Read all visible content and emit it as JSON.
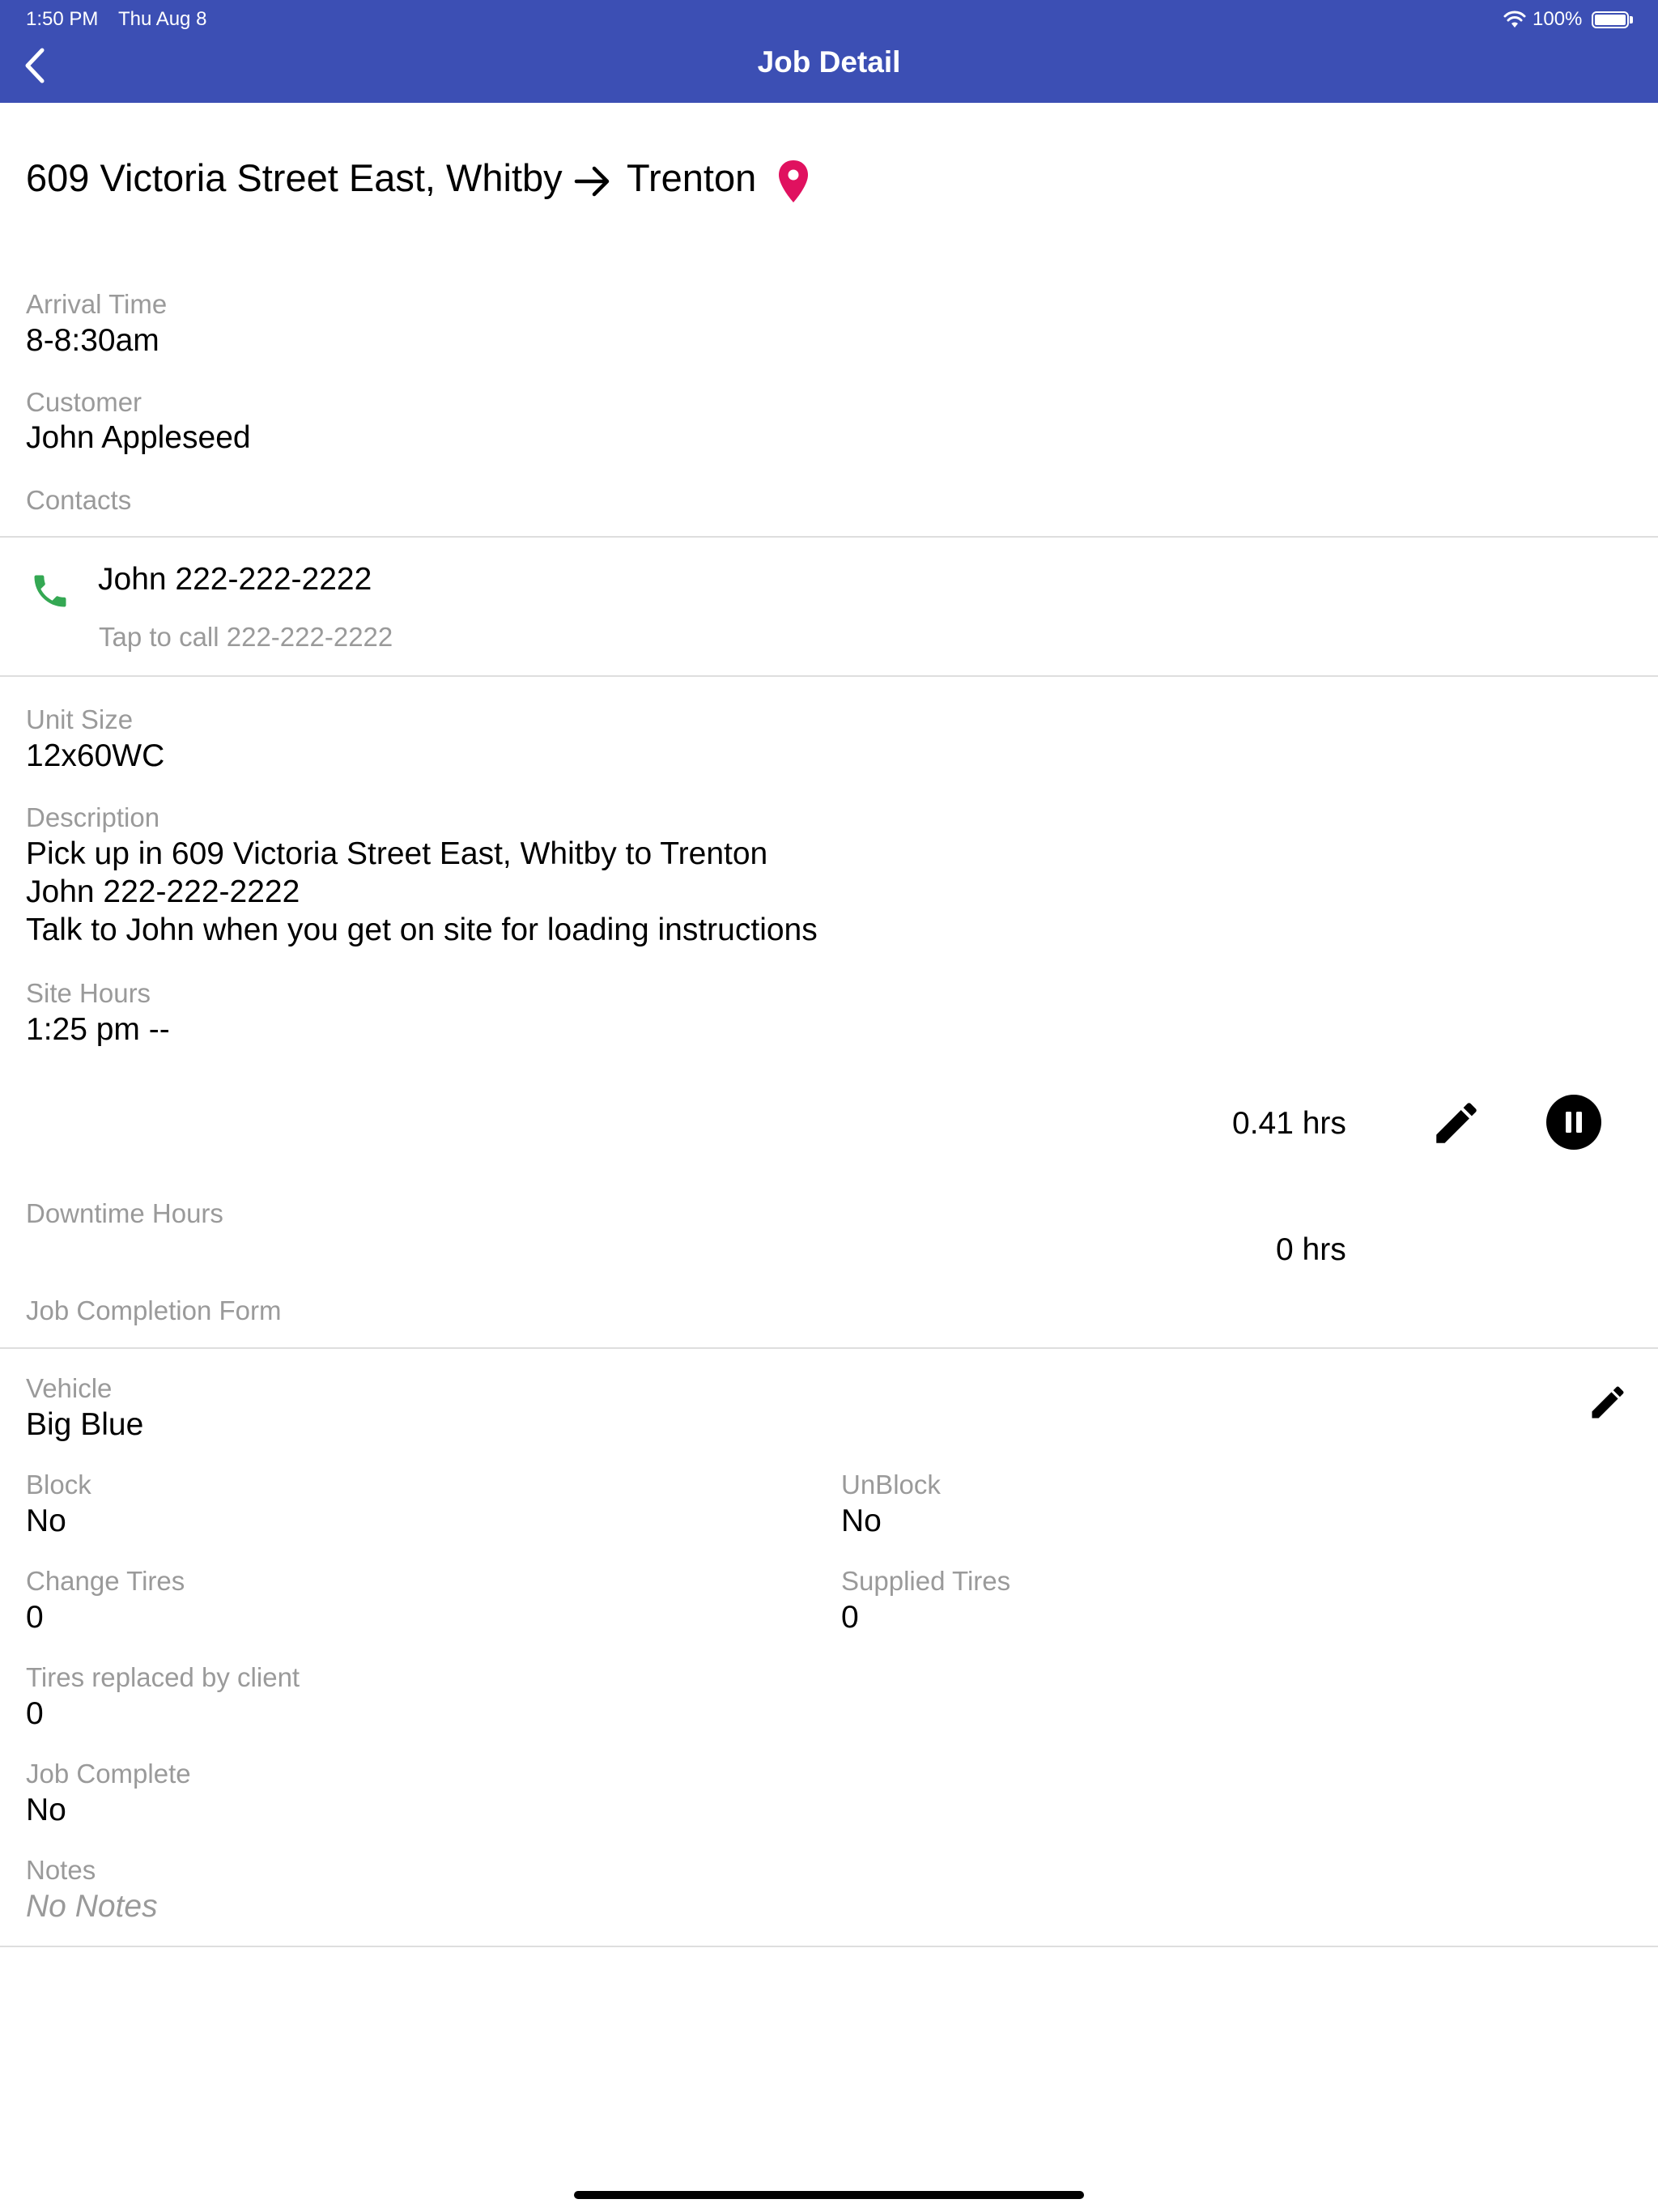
{
  "status_bar": {
    "time": "1:50 PM",
    "date": "Thu Aug 8",
    "battery": "100%"
  },
  "header": {
    "title": "Job Detail"
  },
  "route": {
    "origin": "609 Victoria Street East, Whitby",
    "destination": "Trenton"
  },
  "arrival": {
    "label": "Arrival Time",
    "value": "8-8:30am"
  },
  "customer": {
    "label": "Customer",
    "value": "John Appleseed"
  },
  "contacts": {
    "label": "Contacts",
    "items": [
      {
        "name": "John 222-222-2222",
        "subtitle": "Tap to call 222-222-2222"
      }
    ]
  },
  "unit_size": {
    "label": "Unit Size",
    "value": "12x60WC"
  },
  "description": {
    "label": "Description",
    "lines": [
      "Pick up in 609 Victoria Street East, Whitby to Trenton",
      "John 222-222-2222",
      "Talk to John when you get on site for loading instructions"
    ]
  },
  "site_hours": {
    "label": "Site Hours",
    "value": "1:25 pm --",
    "timer": "0.41 hrs"
  },
  "downtime": {
    "label": "Downtime Hours",
    "value": "0 hrs"
  },
  "completion_form": {
    "label": "Job Completion Form",
    "vehicle": {
      "label": "Vehicle",
      "value": "Big Blue"
    },
    "block": {
      "label": "Block",
      "value": "No"
    },
    "unblock": {
      "label": "UnBlock",
      "value": "No"
    },
    "change_tires": {
      "label": "Change Tires",
      "value": "0"
    },
    "supplied_tires": {
      "label": "Supplied Tires",
      "value": "0"
    },
    "tires_replaced": {
      "label": "Tires replaced by client",
      "value": "0"
    },
    "job_complete": {
      "label": "Job Complete",
      "value": "No"
    },
    "notes": {
      "label": "Notes",
      "value": "No Notes"
    }
  },
  "colors": {
    "header": "#3c4fb4",
    "pin": "#e0115f",
    "phone": "#34a853"
  }
}
